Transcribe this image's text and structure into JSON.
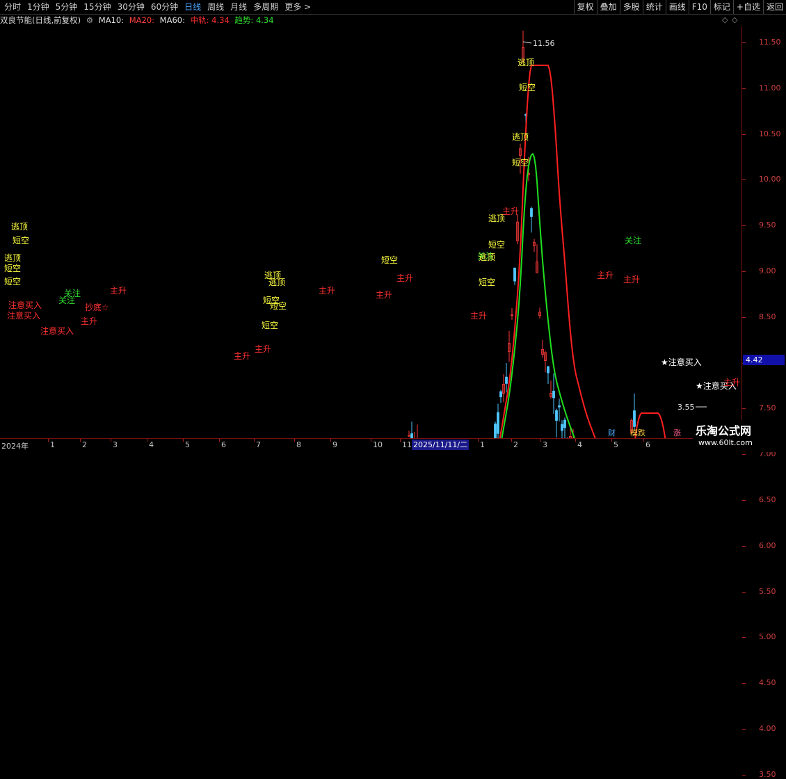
{
  "toolbar": {
    "periods": [
      "分时",
      "1分钟",
      "5分钟",
      "15分钟",
      "30分钟",
      "60分钟",
      "日线",
      "周线",
      "月线",
      "多周期",
      "更多 >"
    ],
    "active_period": "日线",
    "right_buttons": [
      "复权",
      "叠加",
      "多股",
      "统计",
      "画线",
      "F10",
      "标记",
      "+自选",
      "返回"
    ]
  },
  "indicator": {
    "name": "双良节能(日线,前复权)",
    "ma10": "MA10:",
    "ma20": "MA20:",
    "ma60": "MA60:",
    "zhonggui": "中轨: 4.34",
    "qushi": "趋势: 4.34"
  },
  "y_axis": {
    "ticks": [
      "11.50",
      "11.00",
      "10.50",
      "10.00",
      "9.50",
      "9.00",
      "8.50",
      "8.00",
      "7.50",
      "7.00",
      "6.50",
      "6.00",
      "5.50",
      "5.00",
      "4.50",
      "4.00",
      "3.50"
    ],
    "current_price": "4.42"
  },
  "x_axis": {
    "labels": [
      "2024年",
      "1",
      "2",
      "3",
      "4",
      "5",
      "6",
      "7",
      "8",
      "9",
      "10",
      "11",
      "1",
      "2",
      "3",
      "4",
      "5",
      "6"
    ],
    "cursor_date": "2025/11/11/二"
  },
  "chart_data": {
    "type": "line",
    "price_high": "11.56",
    "price_low": "3.55",
    "series": [
      {
        "name": "中轨",
        "color": "#ff2020"
      },
      {
        "name": "趋势",
        "color": "#20e020"
      }
    ],
    "signal_labels": [
      "逃顶",
      "短空",
      "注意买入",
      "关注",
      "主升",
      "抄底",
      "★注意买入"
    ]
  },
  "bottom": {
    "cai": "财",
    "moniu": "模跌",
    "zhang": "涨"
  },
  "watermark": {
    "title": "乐淘公式网",
    "url": "www.60lt.com"
  },
  "colors": {
    "red": "#ff2020",
    "green": "#20e020",
    "yellow": "#ffff40",
    "cyan": "#50d0ff"
  }
}
